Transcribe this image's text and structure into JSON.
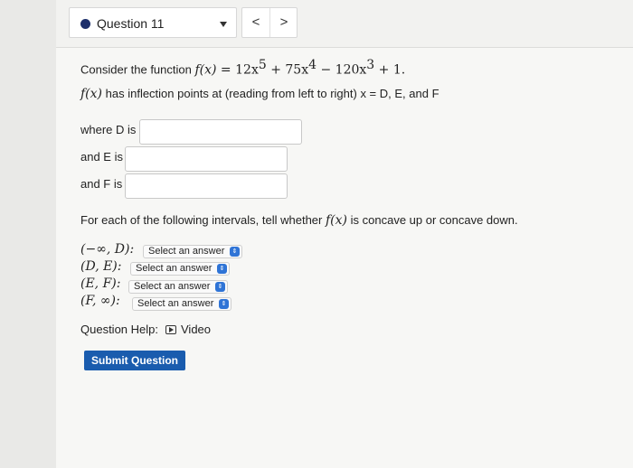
{
  "header": {
    "question_label": "Question 11",
    "prev_label": "<",
    "next_label": ">"
  },
  "problem": {
    "intro_prefix": "Consider the function",
    "function_lhs": "f(x) = ",
    "function_rhs_part1": "12x",
    "exp1": "5",
    "function_rhs_part2": " + 75x",
    "exp2": "4",
    "function_rhs_part3": " − 120x",
    "exp3": "3",
    "function_rhs_part4": " + 1.",
    "inflection_fx": "f(x)",
    "inflection_text": "has inflection points at (reading from left to right) x = D, E, and F"
  },
  "answers": [
    {
      "label": "where D is",
      "value": ""
    },
    {
      "label": "and E is",
      "value": ""
    },
    {
      "label": "and F is",
      "value": ""
    }
  ],
  "concavity": {
    "prompt_prefix": "For each of the following intervals, tell whether",
    "prompt_fx": "f(x)",
    "prompt_suffix": "is concave up or concave down.",
    "intervals": [
      {
        "label": "(−∞, D):",
        "selected": "Select an answer"
      },
      {
        "label": "(D, E):",
        "selected": "Select an answer"
      },
      {
        "label": "(E, F):",
        "selected": "Select an answer"
      },
      {
        "label": "(F, ∞):",
        "selected": "Select an answer"
      }
    ]
  },
  "help": {
    "label": "Question Help:",
    "video_label": "Video"
  },
  "submit_label": "Submit Question",
  "colors": {
    "accent": "#1a5cae",
    "dot": "#1d2f6b",
    "select_arrow": "#2f74d6"
  }
}
